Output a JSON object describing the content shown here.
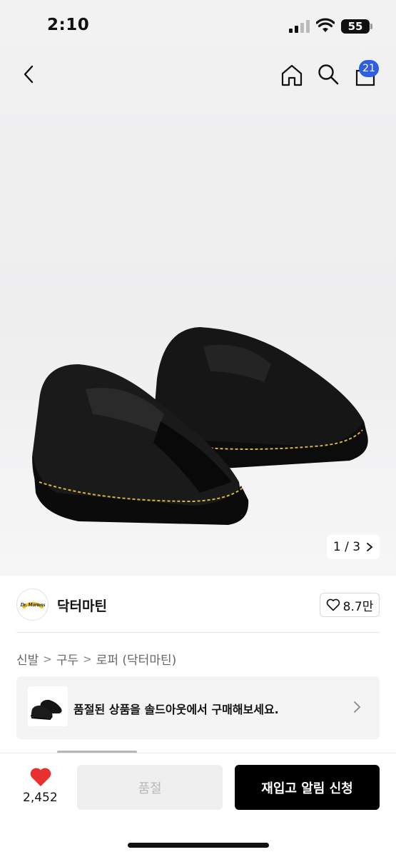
{
  "status_bar": {
    "time": "2:10",
    "battery": "55"
  },
  "header": {
    "back_icon": "chevron-left-icon",
    "home_icon": "home-icon",
    "search_icon": "search-icon",
    "cart_icon": "cart-icon",
    "cart_count": "21"
  },
  "gallery": {
    "counter": "1 / 3"
  },
  "brand": {
    "name": "닥터마틴",
    "likes": "8.7만",
    "logo_text": "Dr. Martens"
  },
  "breadcrumb": [
    "신발",
    "구두",
    "로퍼 (닥터마틴)"
  ],
  "soldout_banner": {
    "text": "품절된 상품을 솔드아웃에서 구매해보세요."
  },
  "bottom": {
    "wish_count": "2,452",
    "soldout_label": "품절",
    "restock_label": "재입고 알림 신청"
  },
  "colors": {
    "accent": "#2f5fe0",
    "heart": "#e8312e",
    "primary_button": "#000000"
  }
}
